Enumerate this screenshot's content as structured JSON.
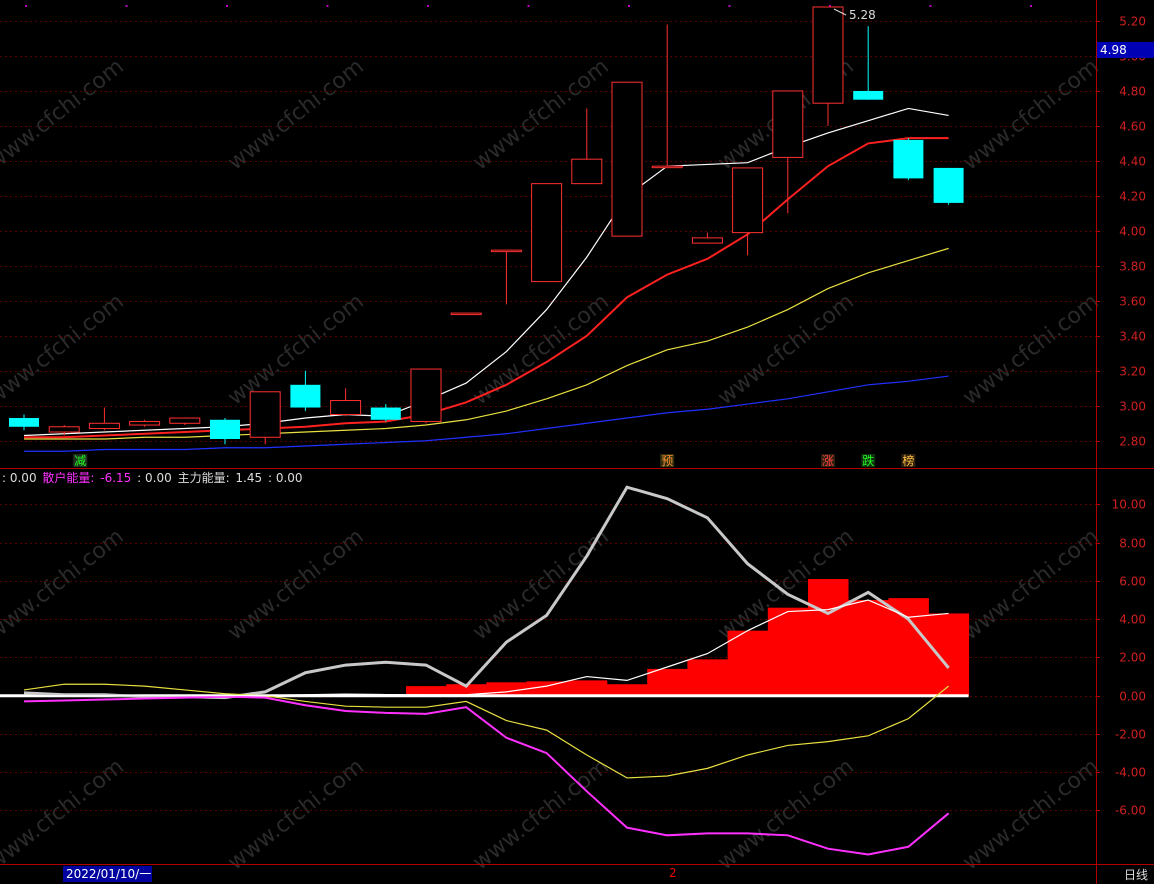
{
  "chart_data": [
    {
      "type": "candlestick",
      "ylim": [
        2.65,
        5.32
      ],
      "yticks": [
        "5.20",
        "5.00",
        "4.80",
        "4.60",
        "4.40",
        "4.20",
        "4.00",
        "3.80",
        "3.60",
        "3.40",
        "3.20",
        "3.00",
        "2.80"
      ],
      "current_price": "4.98",
      "high_label": "5.28",
      "candles": [
        {
          "o": 2.93,
          "c": 2.88,
          "h": 2.95,
          "l": 2.86
        },
        {
          "o": 2.85,
          "c": 2.88,
          "h": 2.89,
          "l": 2.83
        },
        {
          "o": 2.87,
          "c": 2.9,
          "h": 2.99,
          "l": 2.86
        },
        {
          "o": 2.89,
          "c": 2.91,
          "h": 2.92,
          "l": 2.88
        },
        {
          "o": 2.9,
          "c": 2.93,
          "h": 2.93,
          "l": 2.89
        },
        {
          "o": 2.92,
          "c": 2.81,
          "h": 2.93,
          "l": 2.78
        },
        {
          "o": 2.82,
          "c": 3.08,
          "h": 3.08,
          "l": 2.78
        },
        {
          "o": 3.12,
          "c": 2.99,
          "h": 3.2,
          "l": 2.97
        },
        {
          "o": 2.95,
          "c": 3.03,
          "h": 3.1,
          "l": 2.94
        },
        {
          "o": 2.99,
          "c": 2.92,
          "h": 3.01,
          "l": 2.91
        },
        {
          "o": 2.91,
          "c": 3.21,
          "h": 3.21,
          "l": 2.9
        },
        {
          "o": 3.53,
          "c": 3.53,
          "h": 3.53,
          "l": 3.53
        },
        {
          "o": 3.89,
          "c": 3.89,
          "h": 3.89,
          "l": 3.58
        },
        {
          "o": 3.71,
          "c": 4.27,
          "h": 4.27,
          "l": 3.71
        },
        {
          "o": 4.27,
          "c": 4.41,
          "h": 4.7,
          "l": 4.27
        },
        {
          "o": 3.97,
          "c": 4.85,
          "h": 4.85,
          "l": 3.97
        },
        {
          "o": 4.37,
          "c": 4.37,
          "h": 5.18,
          "l": 4.37
        },
        {
          "o": 3.93,
          "c": 3.96,
          "h": 3.99,
          "l": 3.93
        },
        {
          "o": 3.99,
          "c": 4.36,
          "h": 4.36,
          "l": 3.86
        },
        {
          "o": 4.42,
          "c": 4.8,
          "h": 4.8,
          "l": 4.1
        },
        {
          "o": 4.73,
          "c": 5.28,
          "h": 5.28,
          "l": 4.6
        },
        {
          "o": 4.8,
          "c": 4.75,
          "h": 5.17,
          "l": 4.75
        },
        {
          "o": 4.52,
          "c": 4.3,
          "h": 4.53,
          "l": 4.29
        },
        {
          "o": 4.36,
          "c": 4.16,
          "h": 4.36,
          "l": 4.15
        }
      ],
      "ma_series": [
        {
          "color": "#ffffff",
          "values": [
            2.83,
            2.84,
            2.85,
            2.86,
            2.87,
            2.88,
            2.9,
            2.93,
            2.95,
            2.94,
            3.03,
            3.13,
            3.31,
            3.55,
            3.85,
            4.2,
            4.37,
            4.38,
            4.39,
            4.48,
            4.56,
            4.63,
            4.7,
            4.66
          ]
        },
        {
          "color": "#ff2020",
          "values": [
            2.82,
            2.82,
            2.83,
            2.84,
            2.85,
            2.86,
            2.87,
            2.88,
            2.9,
            2.91,
            2.95,
            3.02,
            3.12,
            3.25,
            3.4,
            3.62,
            3.75,
            3.84,
            3.98,
            4.18,
            4.37,
            4.5,
            4.53,
            4.53
          ]
        },
        {
          "color": "#e8e040",
          "values": [
            2.81,
            2.81,
            2.81,
            2.82,
            2.82,
            2.83,
            2.84,
            2.85,
            2.86,
            2.87,
            2.89,
            2.92,
            2.97,
            3.04,
            3.12,
            3.23,
            3.32,
            3.37,
            3.45,
            3.55,
            3.67,
            3.76,
            3.83,
            3.9
          ]
        },
        {
          "color": "#2030ff",
          "values": [
            2.74,
            2.74,
            2.75,
            2.75,
            2.75,
            2.76,
            2.76,
            2.77,
            2.78,
            2.79,
            2.8,
            2.82,
            2.84,
            2.87,
            2.9,
            2.93,
            2.96,
            2.98,
            3.01,
            3.04,
            3.08,
            3.12,
            3.14,
            3.17
          ]
        }
      ],
      "signals": [
        {
          "index": 1,
          "text": "减",
          "color": "#20ff20",
          "bg": "#203020"
        },
        {
          "index": 16,
          "text": "预",
          "color": "#ff9030",
          "bg": "#303010"
        },
        {
          "index": 20,
          "text": "涨",
          "color": "#ff4040",
          "bg": "#302010"
        },
        {
          "index": 21,
          "text": "跌",
          "color": "#20ff20",
          "bg": "#103010"
        },
        {
          "index": 22,
          "text": "榜",
          "color": "#ffc040",
          "bg": "#302010"
        }
      ]
    },
    {
      "type": "line+bar",
      "ylim": [
        -8.8,
        11.8
      ],
      "yticks": [
        "10.00",
        "8.00",
        "6.00",
        "4.00",
        "2.00",
        "0.00",
        "-2.00",
        "-4.00",
        "-6.00"
      ],
      "legend": [
        {
          "label": "",
          "value": ": 0.00",
          "color": "#dddddd"
        },
        {
          "label": "散户能量: ",
          "value": "-6.15",
          "color": "#ff30ff"
        },
        {
          "label": "",
          "value": ": 0.00",
          "color": "#dddddd"
        },
        {
          "label": "主力能量: ",
          "value": "1.45",
          "color": "#dddddd"
        },
        {
          "label": "",
          "value": ": 0.00",
          "color": "#dddddd"
        }
      ],
      "bars": [
        0,
        0,
        0,
        0,
        0,
        0,
        0,
        0,
        0,
        0,
        0.5,
        0.6,
        0.7,
        0.75,
        0.8,
        0.6,
        1.4,
        1.9,
        3.4,
        4.6,
        6.1,
        5.0,
        5.1,
        4.3
      ],
      "series": [
        {
          "color": "#c8c8c8",
          "values": [
            0.15,
            0.05,
            0.05,
            -0.05,
            -0.05,
            -0.1,
            0.2,
            1.2,
            1.6,
            1.75,
            1.6,
            0.5,
            2.8,
            4.2,
            7.3,
            10.9,
            10.3,
            9.3,
            6.9,
            5.3,
            4.3,
            5.4,
            4.0,
            1.45
          ]
        },
        {
          "color": "#ff30ff",
          "values": [
            -0.3,
            -0.25,
            -0.2,
            -0.15,
            -0.1,
            -0.05,
            -0.1,
            -0.5,
            -0.8,
            -0.9,
            -0.95,
            -0.6,
            -2.2,
            -3.0,
            -5.0,
            -6.9,
            -7.3,
            -7.2,
            -7.2,
            -7.3,
            -8.0,
            -8.3,
            -7.9,
            -6.15
          ]
        },
        {
          "color": "#e8e040",
          "values": [
            0.3,
            0.6,
            0.6,
            0.5,
            0.3,
            0.1,
            0.0,
            -0.3,
            -0.55,
            -0.6,
            -0.6,
            -0.3,
            -1.3,
            -1.8,
            -3.1,
            -4.3,
            -4.2,
            -3.8,
            -3.1,
            -2.6,
            -2.4,
            -2.1,
            -1.2,
            0.5
          ]
        },
        {
          "color": "#ffffff",
          "values": [
            0,
            0,
            0,
            0,
            0,
            0,
            0.02,
            0.05,
            0.08,
            0.06,
            0.05,
            0.05,
            0.2,
            0.5,
            1.0,
            0.8,
            1.5,
            2.2,
            3.4,
            4.4,
            4.5,
            5.0,
            4.1,
            4.3
          ]
        }
      ]
    }
  ],
  "bottom": {
    "date": "2022/01/10/一",
    "page": "2",
    "period": "日线"
  },
  "watermark": "www.cfchi.com"
}
